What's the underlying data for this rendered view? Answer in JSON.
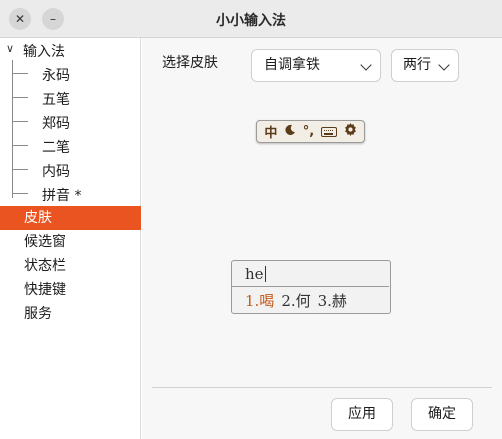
{
  "window": {
    "title": "小小输入法",
    "close_glyph": "✕",
    "min_glyph": "–"
  },
  "sidebar": {
    "root_label": "输入法",
    "root_chevron": "∨",
    "children": [
      "永码",
      "五笔",
      "郑码",
      "二笔",
      "内码",
      "拼音 *"
    ],
    "items": [
      {
        "label": "皮肤",
        "active": true
      },
      {
        "label": "候选窗",
        "active": false
      },
      {
        "label": "状态栏",
        "active": false
      },
      {
        "label": "快捷键",
        "active": false
      },
      {
        "label": "服务",
        "active": false
      }
    ]
  },
  "skin": {
    "label": "选择皮肤",
    "selected": "自调拿铁",
    "lines_selected": "两行"
  },
  "status_preview": {
    "mode": "中",
    "moon_icon": "moon-icon",
    "punct": "°,",
    "keyboard_icon": "keyboard-icon",
    "gear_icon": "gear-icon"
  },
  "candidate_preview": {
    "input": "he",
    "candidates": [
      "1.喝",
      "2.何",
      "3.赫"
    ]
  },
  "buttons": {
    "apply": "应用",
    "ok": "确定"
  },
  "colors": {
    "accent": "#e95420",
    "candidate_highlight": "#c35a1c",
    "status_text": "#5a3b1a"
  }
}
